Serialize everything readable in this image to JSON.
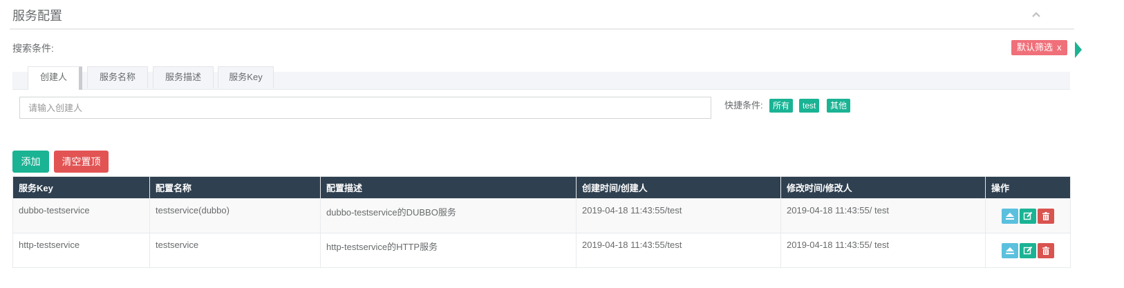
{
  "panel": {
    "title": "服务配置"
  },
  "search": {
    "label": "搜索条件:",
    "default_filter": "默认筛选",
    "default_filter_close": "x",
    "tabs": [
      {
        "label": "创建人"
      },
      {
        "label": "服务名称"
      },
      {
        "label": "服务描述"
      },
      {
        "label": "服务Key"
      }
    ],
    "placeholder": "请输入创建人",
    "quick_label": "快捷条件:",
    "quick_tags": [
      "所有",
      "test",
      "其他"
    ]
  },
  "actions": {
    "add": "添加",
    "clear_top": "清空置顶"
  },
  "table": {
    "headers": [
      "服务Key",
      "配置名称",
      "配置描述",
      "创建时间/创建人",
      "修改时间/修改人",
      "操作"
    ],
    "rows": [
      [
        "dubbo-testservice",
        "testservice(dubbo)",
        "dubbo-testservice的DUBBO服务",
        "2019-04-18 11:43:55/test",
        "2019-04-18 11:43:55/ test"
      ],
      [
        "http-testservice",
        "testservice",
        "http-testservice的HTTP服务",
        "2019-04-18 11:43:55/test",
        "2019-04-18 11:43:55/ test"
      ]
    ]
  },
  "colors": {
    "accent": "#1ab394",
    "danger": "#e25454",
    "header_bg": "#2f4050",
    "filter_tag": "#f0707a",
    "info": "#5bc0de"
  },
  "icons": {
    "collapse": "chevron-up-icon",
    "view": "eject-icon",
    "edit": "edit-icon",
    "delete": "trash-icon"
  }
}
